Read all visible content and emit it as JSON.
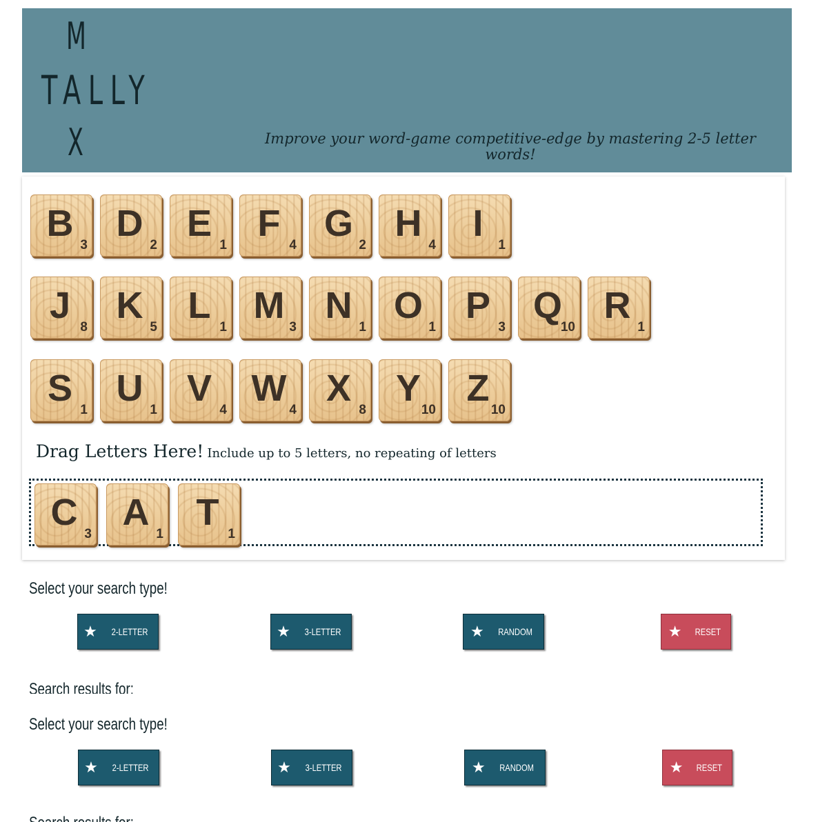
{
  "header": {
    "logo_top": "M",
    "logo_word": "TALLY",
    "logo_bottom": "X",
    "tagline": "Improve your word-game competitive-edge by mastering 2-5 letter words!"
  },
  "tiles": {
    "row1": [
      {
        "letter": "B",
        "points": "3"
      },
      {
        "letter": "D",
        "points": "2"
      },
      {
        "letter": "E",
        "points": "1"
      },
      {
        "letter": "F",
        "points": "4"
      },
      {
        "letter": "G",
        "points": "2"
      },
      {
        "letter": "H",
        "points": "4"
      },
      {
        "letter": "I",
        "points": "1"
      }
    ],
    "row2": [
      {
        "letter": "J",
        "points": "8"
      },
      {
        "letter": "K",
        "points": "5"
      },
      {
        "letter": "L",
        "points": "1"
      },
      {
        "letter": "M",
        "points": "3"
      },
      {
        "letter": "N",
        "points": "1"
      },
      {
        "letter": "O",
        "points": "1"
      },
      {
        "letter": "P",
        "points": "3"
      },
      {
        "letter": "Q",
        "points": "10"
      },
      {
        "letter": "R",
        "points": "1"
      }
    ],
    "row3": [
      {
        "letter": "S",
        "points": "1"
      },
      {
        "letter": "U",
        "points": "1"
      },
      {
        "letter": "V",
        "points": "4"
      },
      {
        "letter": "W",
        "points": "4"
      },
      {
        "letter": "X",
        "points": "8"
      },
      {
        "letter": "Y",
        "points": "10"
      },
      {
        "letter": "Z",
        "points": "10"
      }
    ]
  },
  "drag": {
    "heading": "Drag Letters Here!",
    "instructions": "Include up to 5 letters, no repeating of letters"
  },
  "dropped_tiles": [
    {
      "letter": "C",
      "points": "3"
    },
    {
      "letter": "A",
      "points": "1"
    },
    {
      "letter": "T",
      "points": "1"
    }
  ],
  "search": {
    "title": "Select your search type!",
    "buttons": {
      "two_letter": "2-Letter",
      "three_letter": "3-Letter",
      "random": "Random",
      "reset": "Reset"
    },
    "results_label": "Search results for:"
  },
  "search_repeat": {
    "title": "Select your search type!",
    "buttons": {
      "two_letter": "2-Letter",
      "three_letter": "3-Letter",
      "random": "Random",
      "reset": "Reset"
    },
    "results_label": "Search results for:"
  },
  "icons": {
    "button_icon": "star-icon"
  },
  "colors": {
    "header_bg": "#618c99",
    "button_bg": "#1d5a6e",
    "reset_bg": "#c84c5b",
    "text_dark": "#13262b"
  }
}
